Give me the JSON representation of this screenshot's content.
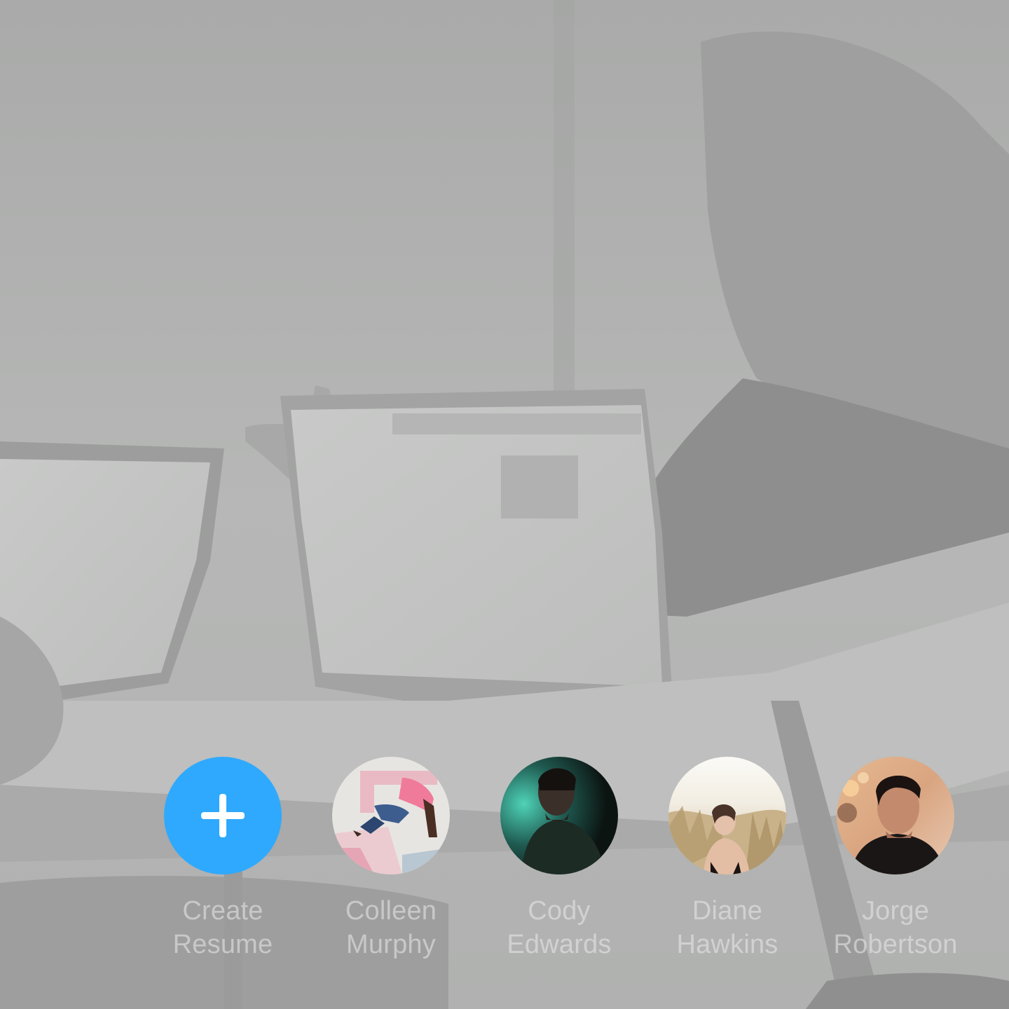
{
  "stories": [
    {
      "type": "create",
      "line1": "Create",
      "line2": "Resume",
      "icon": "plus-icon",
      "color": "#2fa9fd"
    },
    {
      "type": "person",
      "line1": "Colleen",
      "line2": "Murphy",
      "avatar": "avatar-colleen"
    },
    {
      "type": "person",
      "line1": "Cody",
      "line2": "Edwards",
      "avatar": "avatar-cody"
    },
    {
      "type": "person",
      "line1": "Diane",
      "line2": "Hawkins",
      "avatar": "avatar-diane"
    },
    {
      "type": "person",
      "line1": "Jorge",
      "line2": "Robertson",
      "avatar": "avatar-jorge"
    }
  ]
}
